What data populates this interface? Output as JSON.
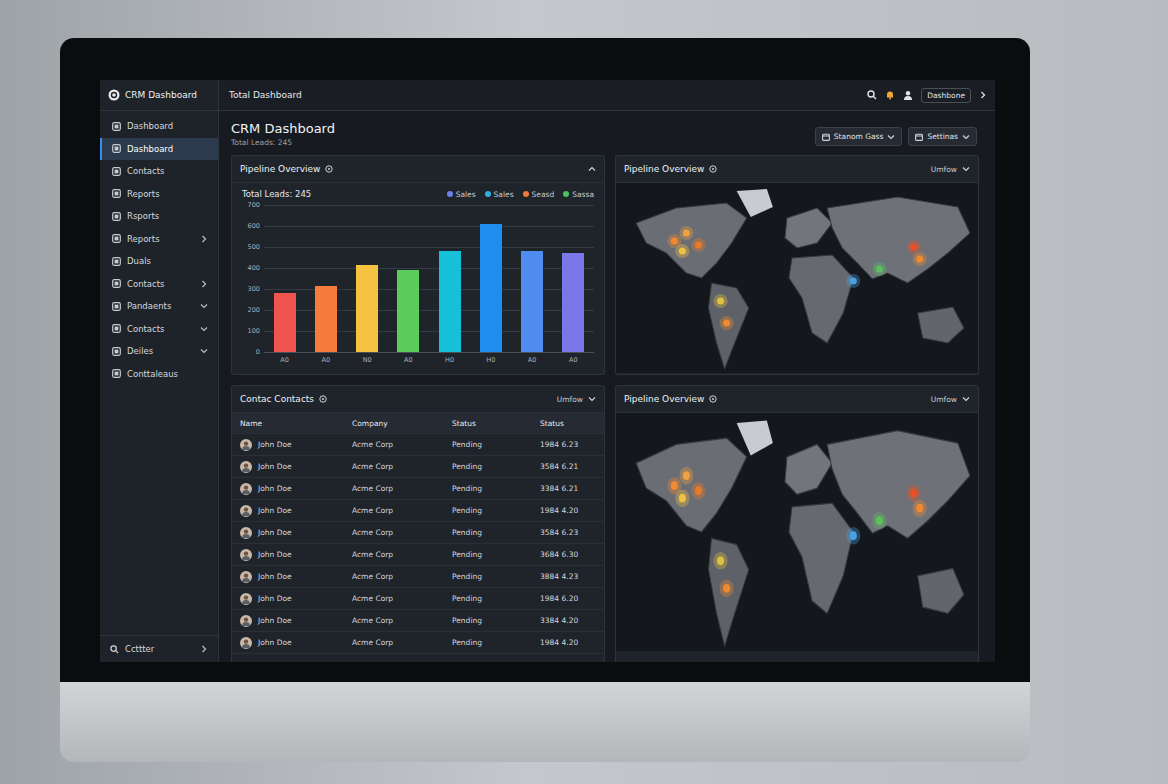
{
  "window": {
    "title": "CRM Dashboard"
  },
  "topbar": {
    "title": "Total Dashboard",
    "user": "Dashbone"
  },
  "header": {
    "title": "CRM Dashboard",
    "subtitle": "Total Leads: 245",
    "buttons": [
      "Stanom Gass",
      "Settinas"
    ]
  },
  "sidebar": {
    "items": [
      {
        "label": "Dashboard",
        "selected": false,
        "kind": "plain"
      },
      {
        "label": "Dashboard",
        "selected": true,
        "kind": "plain"
      },
      {
        "label": "Contacts",
        "selected": false,
        "kind": "plain"
      },
      {
        "label": "Reports",
        "selected": false,
        "kind": "plain"
      },
      {
        "label": "Rsports",
        "selected": false,
        "kind": "plain"
      },
      {
        "label": "Reports",
        "selected": false,
        "kind": "right"
      },
      {
        "label": "Duals",
        "selected": false,
        "kind": "plain"
      },
      {
        "label": "Contacts",
        "selected": false,
        "kind": "right"
      },
      {
        "label": "Pandaents",
        "selected": false,
        "kind": "down"
      },
      {
        "label": "Contacts",
        "selected": false,
        "kind": "down"
      },
      {
        "label": "Deiles",
        "selected": false,
        "kind": "down"
      },
      {
        "label": "Conttaleaus",
        "selected": false,
        "kind": "plain"
      }
    ],
    "footer": "Ccttter"
  },
  "chart": {
    "title": "Pipeline Overview",
    "total": "Total Leads: 245",
    "legend": [
      {
        "label": "Sales",
        "color": "#6f7fe8"
      },
      {
        "label": "Sales",
        "color": "#2fb0e0"
      },
      {
        "label": "Seasd",
        "color": "#f07a3a"
      },
      {
        "label": "Sassa",
        "color": "#4cc060"
      }
    ],
    "ticks": [
      "700",
      "600",
      "500",
      "400",
      "300",
      "200",
      "100",
      "0"
    ],
    "max": 700,
    "bars": [
      {
        "label": "A0",
        "value": 280,
        "color": "#f0544f"
      },
      {
        "label": "A0",
        "value": 312,
        "color": "#f57c3a"
      },
      {
        "label": "N0",
        "value": 416,
        "color": "#f5c242"
      },
      {
        "label": "A0",
        "value": 392,
        "color": "#5ccc5c"
      },
      {
        "label": "H0",
        "value": 482,
        "color": "#16c0d8"
      },
      {
        "label": "H0",
        "value": 610,
        "color": "#1f8ef0"
      },
      {
        "label": "A0",
        "value": 482,
        "color": "#4f8cf0"
      },
      {
        "label": "A0",
        "value": 473,
        "color": "#7a78e8"
      }
    ]
  },
  "maps": [
    {
      "title": "Pipeline Overview",
      "filter": "Umfow",
      "pins": [
        {
          "color": "#f08a30"
        },
        {
          "color": "#f0a040"
        },
        {
          "color": "#e87a28"
        },
        {
          "color": "#f0c040"
        },
        {
          "color": "#e0c040"
        },
        {
          "color": "#f08a30"
        },
        {
          "color": "#5cc060"
        },
        {
          "color": "#e8502a"
        },
        {
          "color": "#f08a30"
        },
        {
          "color": "#4aa0e0"
        }
      ]
    },
    {
      "title": "Pipeline Overview",
      "filter": "Umfow",
      "pins": [
        {
          "color": "#f08a30"
        },
        {
          "color": "#f0a040"
        },
        {
          "color": "#e87a28"
        },
        {
          "color": "#f0c040"
        },
        {
          "color": "#e0c040"
        },
        {
          "color": "#f08a30"
        },
        {
          "color": "#5cc060"
        },
        {
          "color": "#e8502a"
        },
        {
          "color": "#f08a30"
        },
        {
          "color": "#4aa0e0"
        }
      ]
    }
  ],
  "contacts": {
    "title": "Contac Contacts",
    "filter": "Umfow",
    "columns": [
      "Name",
      "Company",
      "Status",
      "Status"
    ],
    "rows": [
      {
        "name": "John Doe",
        "company": "Acme Corp",
        "status": "Pending",
        "date": "1984 6.23"
      },
      {
        "name": "John Doe",
        "company": "Acme Corp",
        "status": "Pending",
        "date": "3584 6.21"
      },
      {
        "name": "John Doe",
        "company": "Acme Corp",
        "status": "Pending",
        "date": "3384 6.21"
      },
      {
        "name": "John Doe",
        "company": "Acme Corp",
        "status": "Pending",
        "date": "1984 4.20"
      },
      {
        "name": "John Doe",
        "company": "Acme Corp",
        "status": "Pending",
        "date": "3584 6.23"
      },
      {
        "name": "John Doe",
        "company": "Acme Corp",
        "status": "Pending",
        "date": "3684 6.30"
      },
      {
        "name": "John Doe",
        "company": "Acme Corp",
        "status": "Pending",
        "date": "3884 4.23"
      },
      {
        "name": "John Doe",
        "company": "Acme Corp",
        "status": "Pending",
        "date": "1984 6.20"
      },
      {
        "name": "John Doe",
        "company": "Acme Corp",
        "status": "Pending",
        "date": "3384 4.20"
      },
      {
        "name": "John Doe",
        "company": "Acme Corp",
        "status": "Pending",
        "date": "1984 4.20"
      }
    ]
  }
}
